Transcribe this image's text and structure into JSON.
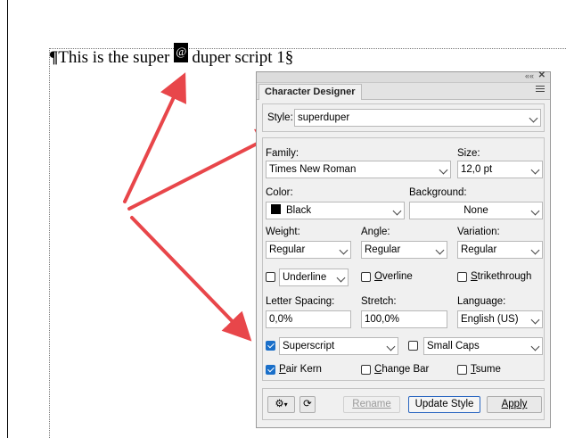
{
  "document": {
    "pilcrow": "¶",
    "text_before": "This is the super",
    "superscript": "@",
    "text_after": "duper script 1§"
  },
  "panel": {
    "tab_title": "Character Designer",
    "style": {
      "label": "Style:",
      "value": "superduper"
    },
    "family": {
      "label": "Family:",
      "value": "Times New Roman"
    },
    "size": {
      "label": "Size:",
      "value": "12,0 pt"
    },
    "color": {
      "label": "Color:",
      "value": "Black",
      "swatch": "#000000"
    },
    "background": {
      "label": "Background:",
      "value": "None"
    },
    "weight": {
      "label": "Weight:",
      "value": "Regular"
    },
    "angle": {
      "label": "Angle:",
      "value": "Regular"
    },
    "variation": {
      "label": "Variation:",
      "value": "Regular"
    },
    "underline": {
      "checked": false,
      "value": "Underline"
    },
    "overline": {
      "checked": false,
      "label": "Overline"
    },
    "strikethrough": {
      "checked": false,
      "label": "Strikethrough"
    },
    "letter_spacing": {
      "label": "Letter Spacing:",
      "value": "0,0%"
    },
    "stretch": {
      "label": "Stretch:",
      "value": "100,0%"
    },
    "language": {
      "label": "Language:",
      "value": "English (US)"
    },
    "position": {
      "checked": true,
      "value": "Superscript"
    },
    "caps": {
      "checked": false,
      "value": "Small Caps"
    },
    "pair_kern": {
      "checked": true,
      "label": "Pair Kern"
    },
    "change_bar": {
      "checked": false,
      "label": "Change Bar"
    },
    "tsume": {
      "checked": false,
      "label": "Tsume"
    },
    "buttons": {
      "rename": "Rename",
      "update_style": "Update Style",
      "apply": "Apply"
    },
    "accent": "#1a6fc9"
  }
}
